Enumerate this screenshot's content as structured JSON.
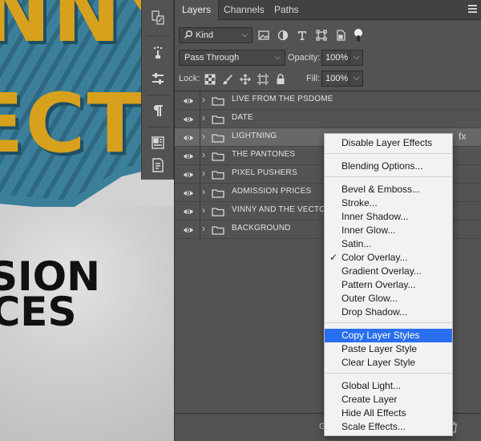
{
  "artwork": {
    "title_line1": "INNY",
    "title_line2": "ECT",
    "lower_line1": "SION",
    "lower_line2": "ICES"
  },
  "panel": {
    "tabs": [
      {
        "label": "Layers",
        "active": true
      },
      {
        "label": "Channels",
        "active": false
      },
      {
        "label": "Paths",
        "active": false
      }
    ],
    "filter": {
      "value": "Kind"
    },
    "blend_mode": "Pass Through",
    "opacity_label": "Opacity:",
    "opacity_value": "100%",
    "lock_label": "Lock:",
    "fill_label": "Fill:",
    "fill_value": "100%",
    "footer_label": "Go"
  },
  "layers": [
    {
      "name": "LIVE FROM THE PSDOME",
      "selected": false
    },
    {
      "name": "DATE",
      "selected": false
    },
    {
      "name": "LIGHTNING",
      "selected": true
    },
    {
      "name": "THE PANTONES",
      "selected": false
    },
    {
      "name": "PIXEL PUSHERS",
      "selected": false
    },
    {
      "name": "ADMISSION PRICES",
      "selected": false
    },
    {
      "name": "VINNY AND THE VECTO",
      "selected": false
    },
    {
      "name": "BACKGROUND",
      "selected": false
    }
  ],
  "fx_badge": "fx",
  "context_menu": {
    "items": [
      {
        "label": "Disable Layer Effects",
        "checked": false,
        "highlighted": false
      },
      {
        "label": "Blending Options...",
        "checked": false,
        "highlighted": false
      },
      {
        "label": "Bevel & Emboss...",
        "checked": false,
        "highlighted": false
      },
      {
        "label": "Stroke...",
        "checked": false,
        "highlighted": false
      },
      {
        "label": "Inner Shadow...",
        "checked": false,
        "highlighted": false
      },
      {
        "label": "Inner Glow...",
        "checked": false,
        "highlighted": false
      },
      {
        "label": "Satin...",
        "checked": false,
        "highlighted": false
      },
      {
        "label": "Color Overlay...",
        "checked": true,
        "highlighted": false
      },
      {
        "label": "Gradient Overlay...",
        "checked": false,
        "highlighted": false
      },
      {
        "label": "Pattern Overlay...",
        "checked": false,
        "highlighted": false
      },
      {
        "label": "Outer Glow...",
        "checked": false,
        "highlighted": false
      },
      {
        "label": "Drop Shadow...",
        "checked": false,
        "highlighted": false
      },
      {
        "label": "Copy Layer Styles",
        "checked": false,
        "highlighted": true
      },
      {
        "label": "Paste Layer Style",
        "checked": false,
        "highlighted": false
      },
      {
        "label": "Clear Layer Style",
        "checked": false,
        "highlighted": false
      },
      {
        "label": "Global Light...",
        "checked": false,
        "highlighted": false
      },
      {
        "label": "Create Layer",
        "checked": false,
        "highlighted": false
      },
      {
        "label": "Hide All Effects",
        "checked": false,
        "highlighted": false
      },
      {
        "label": "Scale Effects...",
        "checked": false,
        "highlighted": false
      }
    ],
    "check_glyph": "✓"
  },
  "colors": {
    "panel_bg": "#535353",
    "selected_row": "#686868",
    "menu_highlight": "#2a6ef0",
    "artwork_gold": "#d8a11d",
    "artwork_blue": "#3c7f9a"
  },
  "icons": [
    "search-icon",
    "image-filter-icon",
    "adjustment-filter-icon",
    "type-filter-icon",
    "shape-filter-icon",
    "smart-object-filter-icon",
    "lock-transparent-icon",
    "lock-image-icon",
    "lock-position-icon",
    "lock-artboard-icon",
    "lock-all-icon",
    "eye-icon",
    "folder-icon",
    "chevron-right-icon",
    "trash-icon"
  ]
}
